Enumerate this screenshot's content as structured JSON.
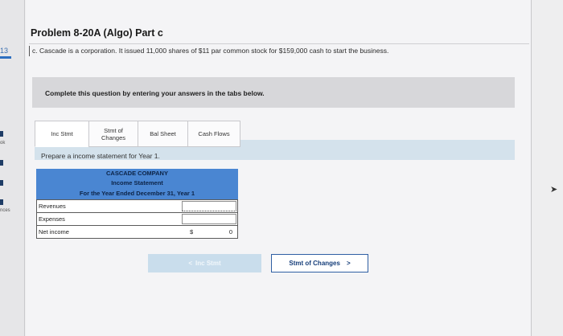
{
  "problem": {
    "title": "Problem 8-20A (Algo) Part c",
    "statement": "c. Cascade is a corporation. It issued 11,000 shares of $11 par common stock for $159,000 cash to start the business."
  },
  "instructions": "Complete this question by entering your answers in the tabs below.",
  "tabs": [
    {
      "label": "Inc Stmt",
      "active": true
    },
    {
      "label": "Stmt of\nChanges",
      "active": false
    },
    {
      "label": "Bal Sheet",
      "active": false
    },
    {
      "label": "Cash Flows",
      "active": false
    }
  ],
  "prompt": "Prepare a income statement for Year 1.",
  "statement": {
    "company": "CASCADE COMPANY",
    "name": "Income Statement",
    "period": "For the Year Ended December 31, Year 1",
    "rows": [
      {
        "label": "Revenues",
        "value": ""
      },
      {
        "label": "Expenses",
        "value": ""
      },
      {
        "label": "Net income",
        "currency": "$",
        "value": "0"
      }
    ]
  },
  "nav": {
    "prev_label": "Inc Stmt",
    "next_label": "Stmt of Changes",
    "prev_icon": "chevron-left-icon",
    "next_icon": "chevron-right-icon"
  },
  "left_nav": {
    "number": "13",
    "labels": [
      "ok",
      "nces"
    ]
  },
  "colors": {
    "header_blue": "#4a86d2",
    "prompt_bar": "#d4e2ec",
    "next_button_border": "#2f5fa3"
  }
}
